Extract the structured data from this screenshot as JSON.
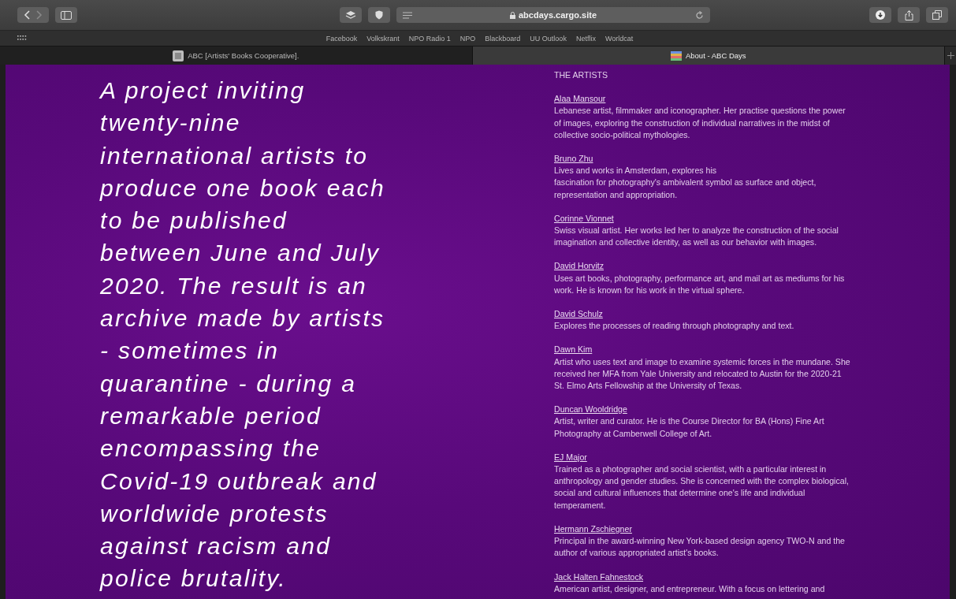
{
  "browser": {
    "url": "abcdays.cargo.site",
    "bookmarks": [
      "Facebook",
      "Volkskrant",
      "NPO Radio 1",
      "NPO",
      "Blackboard",
      "UU Outlook",
      "Netflix",
      "Worldcat"
    ],
    "tabs": [
      {
        "title": "ABC [Artists' Books Cooperative].",
        "selected": false
      },
      {
        "title": "About - ABC Days",
        "selected": true
      }
    ]
  },
  "intro": {
    "lines": [
      "A project inviting",
      "twenty-nine",
      "international artists to",
      "produce one book each",
      "to be published",
      "between June and July",
      "2020. The result is an",
      "archive made by artists",
      "- sometimes in",
      "quarantine - during a",
      "remarkable period",
      "encompassing the",
      "Covid-19 outbreak and",
      "worldwide protests",
      "against racism and",
      "police brutality."
    ]
  },
  "artists_heading": "THE ARTISTS",
  "artists": [
    {
      "name": "Alaa Mansour",
      "bio": [
        "Lebanese artist, filmmaker and iconographer. Her practise questions the power",
        "of images, exploring the construction of individual narratives in the midst of",
        "collective socio-political mythologies."
      ]
    },
    {
      "name": "Bruno Zhu",
      "bio": [
        "Lives and works in Amsterdam, explores his",
        "fascination for photography's ambivalent symbol as surface and object,",
        "representation and appropriation."
      ]
    },
    {
      "name": "Corinne Vionnet",
      "bio": [
        "Swiss visual artist. Her works led her to analyze the construction of the social",
        "imagination and collective identity, as well as our behavior with images."
      ]
    },
    {
      "name": "David Horvitz",
      "bio": [
        "Uses art books, photography, performance art, and mail art as mediums for his",
        "work. He is known for his work in the virtual sphere."
      ]
    },
    {
      "name": "David Schulz",
      "bio": [
        "Explores the processes of reading through photography and text."
      ]
    },
    {
      "name": "Dawn Kim",
      "bio": [
        "Artist who uses text and image to examine systemic forces in the mundane. She",
        "received her MFA from Yale University and relocated to Austin for the 2020-21",
        "St. Elmo Arts Fellowship at the University of Texas."
      ]
    },
    {
      "name": "Duncan Wooldridge",
      "bio": [
        "Artist, writer and curator. He is the Course Director for BA (Hons) Fine Art",
        "Photography at Camberwell College of Art."
      ]
    },
    {
      "name": "EJ Major",
      "bio": [
        "Trained as a photographer and social scientist, with a particular interest in",
        "anthropology and gender studies. She is concerned with the complex biological,",
        "social and cultural influences that determine one's life and individual",
        "temperament."
      ]
    },
    {
      "name": "Hermann Zschiegner",
      "bio": [
        "Principal in the award-winning New York-based design agency TWO-N and the",
        "author of various appropriated artist's books."
      ]
    },
    {
      "name": "Jack Halten Fahnestock",
      "bio": [
        "American artist, designer, and entrepreneur. With a focus on lettering and"
      ]
    }
  ]
}
